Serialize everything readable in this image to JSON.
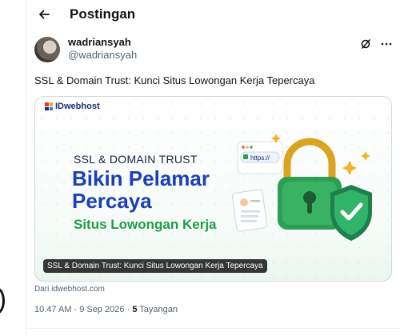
{
  "header": {
    "title": "Postingan",
    "back_icon": "arrow-left-icon"
  },
  "author": {
    "name": "wadriansyah",
    "handle": "@wadriansyah"
  },
  "post": {
    "text": "SSL & Domain Trust: Kunci Situs Lowongan Kerja Tepercaya"
  },
  "card": {
    "brand": "IDwebhost",
    "image_subtitle": "SSL & DOMAIN TRUST",
    "image_title_line1": "Bikin Pelamar",
    "image_title_line2": "Percaya",
    "image_tagline": "Situs Lowongan Kerja",
    "url_chip": "https://",
    "caption": "SSL & Domain Trust: Kunci Situs Lowongan Kerja Tepercaya",
    "source": "Dari idwebhost.com"
  },
  "meta": {
    "time": "10.47 AM · 9 Sep 2026 · ",
    "views_count": "5",
    "views_label": " Tayangan"
  },
  "colors": {
    "title_blue": "#1b3fb8",
    "tag_green": "#1f9d47",
    "lock_green": "#2f9e55",
    "shield_green": "#23a065"
  }
}
